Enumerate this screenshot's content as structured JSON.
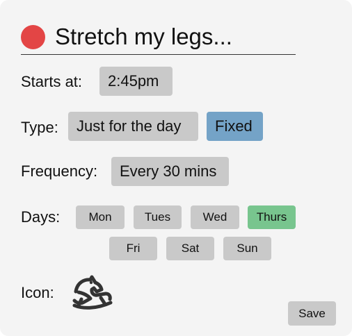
{
  "title": "Stretch my legs...",
  "starts_at": {
    "label": "Starts at:",
    "value": "2:45pm"
  },
  "type": {
    "label": "Type:",
    "options": [
      "Just for the day",
      "Fixed"
    ],
    "selected": "Fixed"
  },
  "frequency": {
    "label": "Frequency:",
    "value": "Every 30 mins"
  },
  "days": {
    "label": "Days:",
    "items": [
      "Mon",
      "Tues",
      "Wed",
      "Thurs",
      "Fri",
      "Sat",
      "Sun"
    ],
    "selected": [
      "Thurs"
    ]
  },
  "icon": {
    "label": "Icon:",
    "name": "rocking-horse-icon"
  },
  "save_label": "Save",
  "colors": {
    "status_dot": "#e34545",
    "selected_type": "#74a3c7",
    "selected_day": "#78c58e",
    "chip_default": "#c9c9c9",
    "background": "#f4f4f4"
  }
}
